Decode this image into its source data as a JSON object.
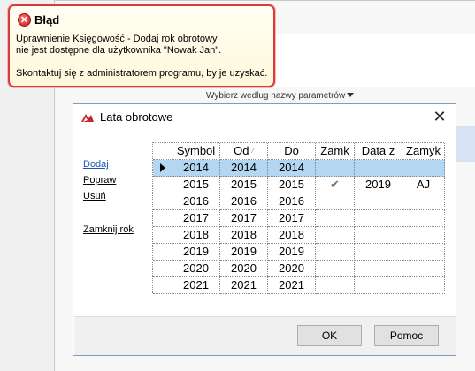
{
  "background": {
    "filter_link": "Wybierz według nazwy parametrów"
  },
  "error_callout": {
    "title": "Błąd",
    "line1": "Uprawnienie Księgowość - Dodaj rok obrotowy",
    "line2": "nie jest dostępne dla użytkownika \"Nowak Jan\".",
    "line3": "Skontaktuj się z administratorem programu, by je uzyskać."
  },
  "dialog": {
    "title": "Lata obrotowe",
    "close_glyph": "✕",
    "actions": {
      "add": "Dodaj",
      "edit": "Popraw",
      "delete": "Usuń",
      "close_year": "Zamknij rok"
    },
    "columns": [
      "Symbol",
      "Od",
      "Do",
      "Zamk",
      "Data z",
      "Zamyk"
    ],
    "rows": [
      {
        "symbol": "2014",
        "od": "2014",
        "do": "2014",
        "zamk": "",
        "data_z": "",
        "zamyk": ""
      },
      {
        "symbol": "2015",
        "od": "2015",
        "do": "2015",
        "zamk": "✔",
        "data_z": "2019",
        "zamyk": "AJ"
      },
      {
        "symbol": "2016",
        "od": "2016",
        "do": "2016",
        "zamk": "",
        "data_z": "",
        "zamyk": ""
      },
      {
        "symbol": "2017",
        "od": "2017",
        "do": "2017",
        "zamk": "",
        "data_z": "",
        "zamyk": ""
      },
      {
        "symbol": "2018",
        "od": "2018",
        "do": "2018",
        "zamk": "",
        "data_z": "",
        "zamyk": ""
      },
      {
        "symbol": "2019",
        "od": "2019",
        "do": "2019",
        "zamk": "",
        "data_z": "",
        "zamyk": ""
      },
      {
        "symbol": "2020",
        "od": "2020",
        "do": "2020",
        "zamk": "",
        "data_z": "",
        "zamyk": ""
      },
      {
        "symbol": "2021",
        "od": "2021",
        "do": "2021",
        "zamk": "",
        "data_z": "",
        "zamyk": ""
      }
    ],
    "buttons": {
      "ok": "OK",
      "help": "Pomoc"
    },
    "colors": {
      "selected_row": "#b3d7f2",
      "error_border": "#d83b3b",
      "link_active": "#1a57b3"
    }
  }
}
